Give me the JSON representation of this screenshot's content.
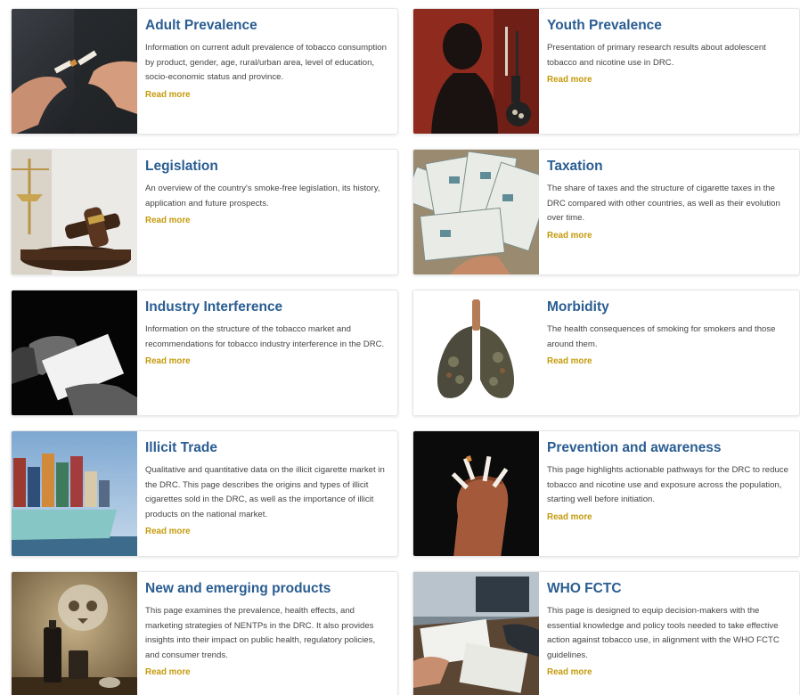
{
  "colors": {
    "title": "#2a5d91",
    "read_more": "#c49a0b",
    "text": "#444444"
  },
  "read_more_label": "Read more",
  "cards": [
    {
      "title": "Adult Prevalence",
      "desc": "Information on current adult prevalence of tobacco consumption by product, gender, age, rural/urban area, level of education, socio-economic status and province.",
      "image": "breaking-cigarette-photo"
    },
    {
      "title": "Youth Prevalence",
      "desc": "Presentation of primary research results about adolescent tobacco and nicotine use in DRC.",
      "image": "youth-silhouette-photo"
    },
    {
      "title": "Legislation",
      "desc": "An overview of the country's smoke-free legislation, its history, application and future prospects.",
      "image": "gavel-scales-photo"
    },
    {
      "title": "Taxation",
      "desc": "The share of taxes and the structure of cigarette taxes in the DRC compared with other countries, as well as their evolution over time.",
      "image": "banknotes-photo"
    },
    {
      "title": "Industry Interference",
      "desc": "Information on the structure of the tobacco market and recommendations for tobacco industry interference in the DRC.",
      "image": "handing-envelope-photo"
    },
    {
      "title": "Morbidity",
      "desc": "The health consequences of smoking for smokers and those around them.",
      "image": "damaged-lungs-photo"
    },
    {
      "title": "Illicit Trade",
      "desc": "Qualitative and quantitative data on the illicit cigarette market in the DRC. This page describes the origins and types of illicit cigarettes sold in the DRC, as well as the importance of illicit products on the national market.",
      "image": "container-ship-photo"
    },
    {
      "title": "Prevention and awareness",
      "desc": "This page highlights actionable pathways for the DRC to reduce tobacco and nicotine use and exposure across the population, starting well before initiation.",
      "image": "fist-crushing-cigarettes-photo"
    },
    {
      "title": "New and emerging products",
      "desc": "This page examines the prevalence, health effects, and marketing strategies of NENTPs in the DRC. It also provides insights into their impact on public health, regulatory policies, and consumer trends.",
      "image": "vape-skull-smoke-photo"
    },
    {
      "title": "WHO FCTC",
      "desc": "This page is designed to equip decision-makers with the essential knowledge and policy tools needed to take effective action against tobacco use, in alignment with the WHO FCTC guidelines.",
      "image": "meeting-documents-photo"
    }
  ]
}
